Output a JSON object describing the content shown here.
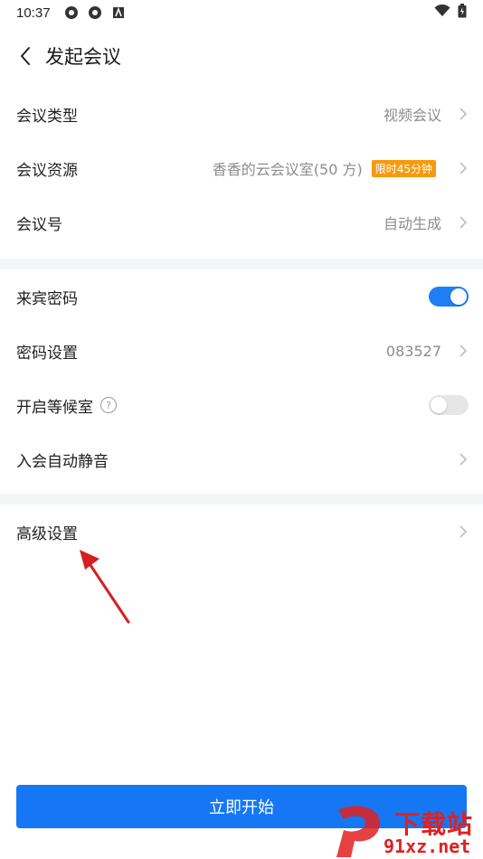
{
  "status_bar": {
    "time": "10:37"
  },
  "header": {
    "title": "发起会议"
  },
  "rows": {
    "meeting_type": {
      "label": "会议类型",
      "value": "视频会议"
    },
    "meeting_resource": {
      "label": "会议资源",
      "value": "香香的云会议室(50 方)",
      "badge": "限时45分钟"
    },
    "meeting_number": {
      "label": "会议号",
      "value": "自动生成"
    },
    "guest_password": {
      "label": "来宾密码",
      "toggle": "on"
    },
    "password_setting": {
      "label": "密码设置",
      "value": "083527"
    },
    "waiting_room": {
      "label": "开启等候室",
      "help": "?",
      "toggle": "off"
    },
    "auto_mute": {
      "label": "入会自动静音"
    },
    "advanced_settings": {
      "label": "高级设置"
    }
  },
  "start_button": {
    "label": "立即开始"
  },
  "watermark": {
    "line1": "下载站",
    "line2": "91xz.net"
  },
  "colors": {
    "accent": "#1677f4",
    "badge": "#f59a0e",
    "watermark": "#e02020",
    "arrow": "#d42020"
  }
}
